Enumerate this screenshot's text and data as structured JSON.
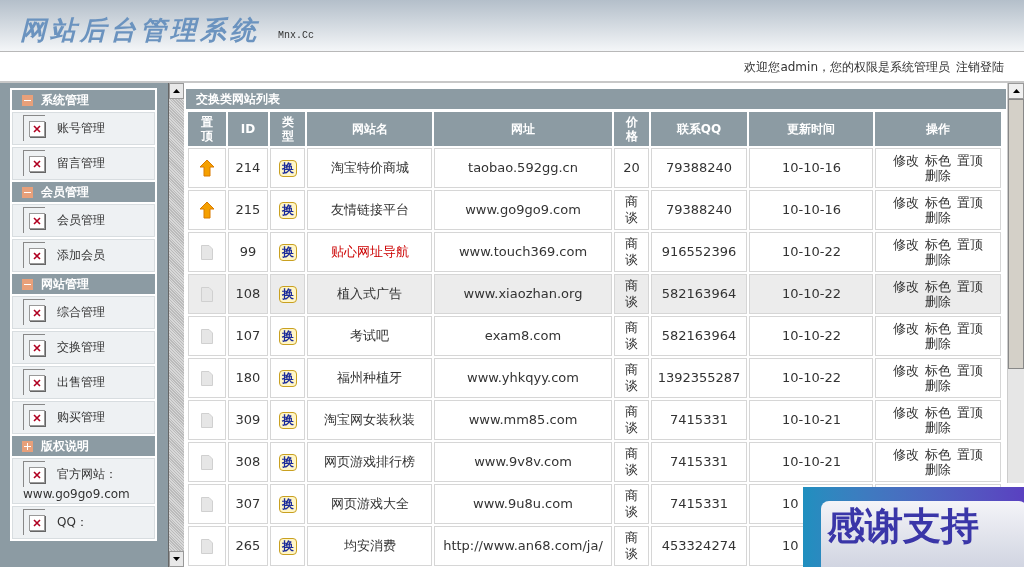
{
  "header": {
    "logo": "网站后台管理系统",
    "domain": "Mnx.Cc"
  },
  "userbar": {
    "welcome": "欢迎您admin，您的权限是系统管理员",
    "logout": "注销登陆"
  },
  "sidebar": [
    {
      "title": "系统管理",
      "expanded": true,
      "items": [
        "账号管理",
        "留言管理"
      ]
    },
    {
      "title": "会员管理",
      "expanded": true,
      "items": [
        "会员管理",
        "添加会员"
      ]
    },
    {
      "title": "网站管理",
      "expanded": true,
      "items": [
        "综合管理",
        "交换管理",
        "出售管理",
        "购买管理"
      ]
    },
    {
      "title": "版权说明",
      "expanded": false,
      "items": [
        "官方网站：www.go9go9.com",
        "QQ："
      ]
    }
  ],
  "table": {
    "title": "交换类网站列表",
    "columns": [
      "置顶",
      "ID",
      "类型",
      "网站名",
      "网址",
      "价格",
      "联系QQ",
      "更新时间",
      "操作"
    ],
    "rows": [
      {
        "pinned": true,
        "highlighted": false,
        "id": "214",
        "type": "换",
        "name": "淘宝特价商城",
        "color": "#333333",
        "url": "taobao.592gg.cn",
        "price": "20",
        "qq": "79388240",
        "updated": "10-10-16",
        "actions": [
          "修改",
          "标色",
          "置顶",
          "删除"
        ]
      },
      {
        "pinned": true,
        "highlighted": false,
        "id": "215",
        "type": "换",
        "name": "友情链接平台",
        "color": "#333333",
        "url": "www.go9go9.com",
        "price": "商谈",
        "qq": "79388240",
        "updated": "10-10-16",
        "actions": [
          "修改",
          "标色",
          "置顶",
          "删除"
        ]
      },
      {
        "pinned": false,
        "highlighted": false,
        "id": "99",
        "type": "换",
        "name": "贴心网址导航",
        "color": "#cc0000",
        "url": "www.touch369.com",
        "price": "商谈",
        "qq": "916552396",
        "updated": "10-10-22",
        "actions": [
          "修改",
          "标色",
          "置顶",
          "删除"
        ]
      },
      {
        "pinned": false,
        "highlighted": true,
        "id": "108",
        "type": "换",
        "name": "植入式广告",
        "color": "#333333",
        "url": "www.xiaozhan.org",
        "price": "商谈",
        "qq": "582163964",
        "updated": "10-10-22",
        "actions": [
          "修改",
          "标色",
          "置顶",
          "删除"
        ]
      },
      {
        "pinned": false,
        "highlighted": false,
        "id": "107",
        "type": "换",
        "name": "考试吧",
        "color": "#333333",
        "url": "exam8.com",
        "price": "商谈",
        "qq": "582163964",
        "updated": "10-10-22",
        "actions": [
          "修改",
          "标色",
          "置顶",
          "删除"
        ]
      },
      {
        "pinned": false,
        "highlighted": false,
        "id": "180",
        "type": "换",
        "name": "福州种植牙",
        "color": "#333333",
        "url": "www.yhkqyy.com",
        "price": "商谈",
        "qq": "1392355287",
        "updated": "10-10-22",
        "actions": [
          "修改",
          "标色",
          "置顶",
          "删除"
        ]
      },
      {
        "pinned": false,
        "highlighted": false,
        "id": "309",
        "type": "换",
        "name": "淘宝网女装秋装",
        "color": "#333333",
        "url": "www.mm85.com",
        "price": "商谈",
        "qq": "7415331",
        "updated": "10-10-21",
        "actions": [
          "修改",
          "标色",
          "置顶",
          "删除"
        ]
      },
      {
        "pinned": false,
        "highlighted": false,
        "id": "308",
        "type": "换",
        "name": "网页游戏排行榜",
        "color": "#333333",
        "url": "www.9v8v.com",
        "price": "商谈",
        "qq": "7415331",
        "updated": "10-10-21",
        "actions": [
          "修改",
          "标色",
          "置顶",
          "删除"
        ]
      },
      {
        "pinned": false,
        "highlighted": false,
        "id": "307",
        "type": "换",
        "name": "网页游戏大全",
        "color": "#333333",
        "url": "www.9u8u.com",
        "price": "商谈",
        "qq": "7415331",
        "updated": "10"
      },
      {
        "pinned": false,
        "highlighted": false,
        "id": "265",
        "type": "换",
        "name": "均安消费",
        "color": "#333333",
        "url": "http://www.an68.com/ja/",
        "price": "商谈",
        "qq": "453324274",
        "updated": "10"
      }
    ]
  },
  "overlay": {
    "text": "感谢支持"
  }
}
